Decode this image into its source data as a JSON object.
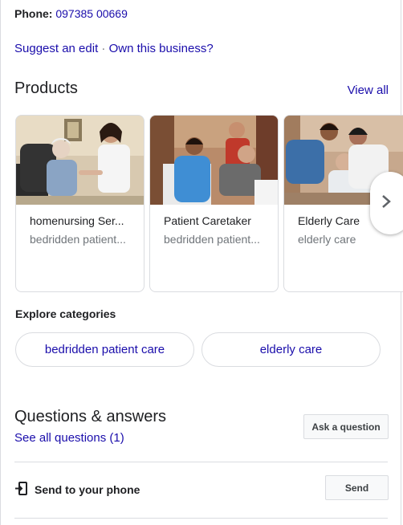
{
  "contact": {
    "phone_label": "Phone:",
    "phone_value": "097385 00669"
  },
  "edit": {
    "suggest": "Suggest an edit",
    "separator": "·",
    "own": "Own this business?"
  },
  "products": {
    "title": "Products",
    "view_all": "View all",
    "items": [
      {
        "title": "homenursing Ser...",
        "subtitle": "bedridden patient..."
      },
      {
        "title": "Patient Caretaker",
        "subtitle": "bedridden patient..."
      },
      {
        "title": "Elderly Care",
        "subtitle": "elderly care"
      }
    ]
  },
  "categories": {
    "title": "Explore categories",
    "chips": [
      "bedridden patient care",
      "elderly care"
    ]
  },
  "qa": {
    "title": "Questions & answers",
    "see_all": "See all questions (1)",
    "ask_button": "Ask a question"
  },
  "send": {
    "label": "Send to your phone",
    "button": "Send"
  },
  "colors": {
    "link": "#1a0dab",
    "border": "#dadce0",
    "muted": "#70757a"
  }
}
